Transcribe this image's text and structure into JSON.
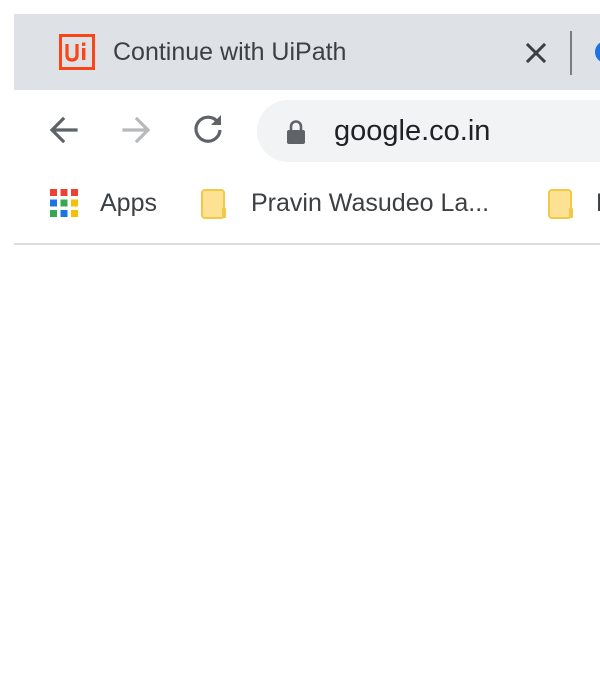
{
  "tab": {
    "title": "Continue with UiPath",
    "favicon_text": "Ui",
    "favicon_color": "#fa4616",
    "close_icon": "close-icon"
  },
  "toolbar": {
    "back_icon": "arrow-left-icon",
    "forward_icon": "arrow-right-icon",
    "reload_icon": "reload-icon",
    "url": "google.co.in",
    "lock_icon": "lock-icon"
  },
  "bookmarks": {
    "items": [
      {
        "label": "Apps",
        "icon": "apps-grid-icon"
      },
      {
        "label": "Pravin Wasudeo La...",
        "icon": "folder-icon"
      },
      {
        "label": "P",
        "icon": "folder-icon"
      }
    ]
  },
  "colors": {
    "tab_strip_bg": "#dee1e6",
    "omnibox_bg": "#f1f3f4",
    "text": "#3c4043",
    "folder_fill": "#fde293",
    "folder_stroke": "#f3c846"
  }
}
